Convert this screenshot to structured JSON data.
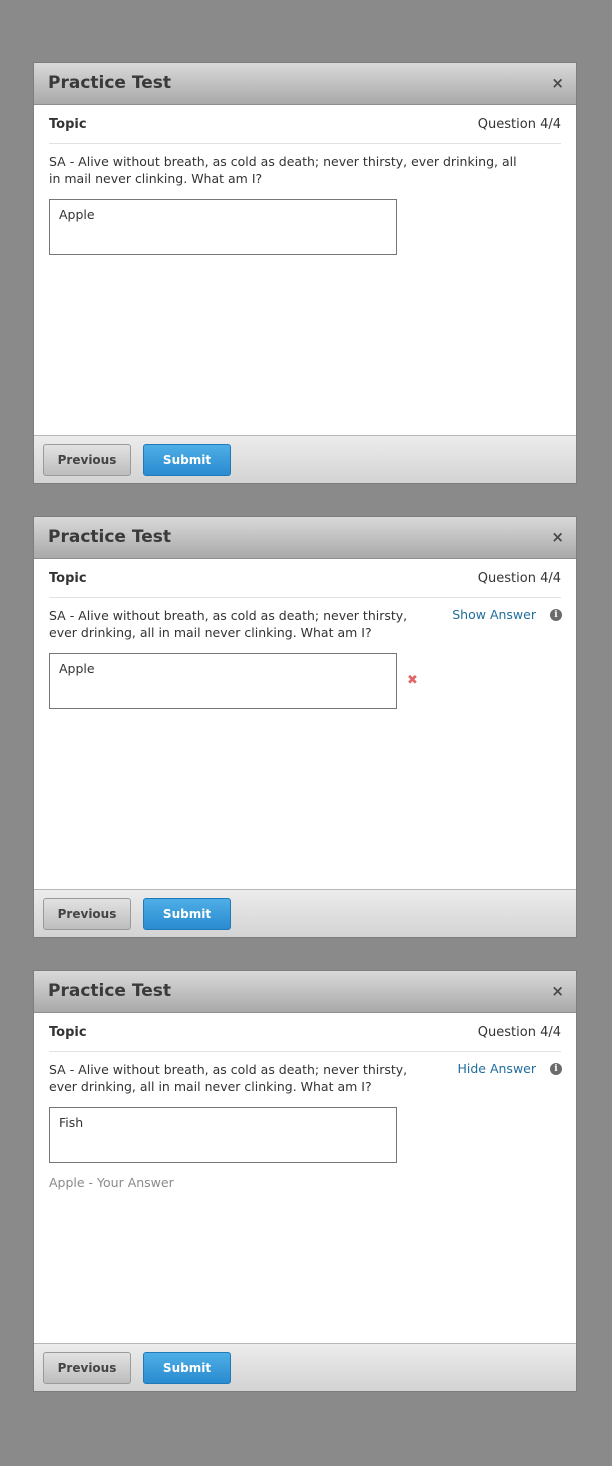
{
  "dialogs": [
    {
      "title": "Practice Test",
      "close_symbol": "×",
      "topic": "Topic",
      "question_number": "Question 4/4",
      "question_text": "SA - Alive without breath, as cold as death; never thirsty, ever drinking, all in mail never clinking. What am I?",
      "answer_value": "Apple",
      "footer": {
        "previous_label": "Previous",
        "submit_label": "Submit"
      }
    },
    {
      "title": "Practice Test",
      "close_symbol": "×",
      "topic": "Topic",
      "question_number": "Question 4/4",
      "question_text": "SA - Alive without breath, as cold as death; never thirsty, ever drinking, all in mail never clinking. What am I?",
      "answer_value": "Apple",
      "answer_toggle_label": "Show Answer",
      "wrong_mark": "✖",
      "info_symbol": "i",
      "footer": {
        "previous_label": "Previous",
        "submit_label": "Submit"
      }
    },
    {
      "title": "Practice Test",
      "close_symbol": "×",
      "topic": "Topic",
      "question_number": "Question 4/4",
      "question_text": "SA - Alive without breath, as cold as death; never thirsty, ever drinking, all in mail never clinking. What am I?",
      "answer_value": "Fish",
      "answer_toggle_label": "Hide Answer",
      "info_symbol": "i",
      "your_answer_text": "Apple - Your Answer",
      "footer": {
        "previous_label": "Previous",
        "submit_label": "Submit"
      }
    }
  ],
  "colors": {
    "page_background": "#8a8a8a",
    "submit_button": "#2a8bd0",
    "link": "#1f6d9c",
    "wrong_mark": "#e06868"
  },
  "icons": {
    "close": "close-icon",
    "wrong": "wrong-answer-icon",
    "info": "info-icon"
  }
}
